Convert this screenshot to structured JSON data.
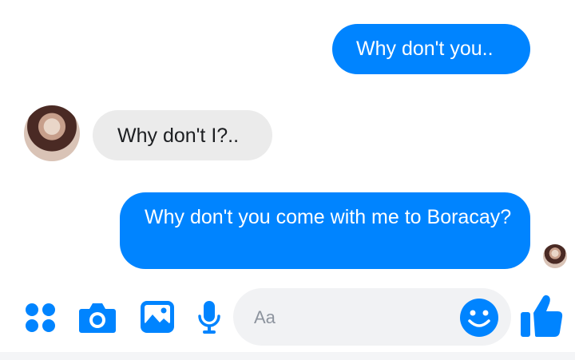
{
  "messages": [
    {
      "direction": "outgoing",
      "text": "Why don't you.."
    },
    {
      "direction": "incoming",
      "text": "Why don't I?.."
    },
    {
      "direction": "outgoing",
      "text": "Why don't you come with me to Boracay?"
    }
  ],
  "composer": {
    "placeholder": "Aa"
  },
  "toolbar": {
    "icons": [
      "more-apps-icon",
      "camera-icon",
      "gallery-icon",
      "microphone-icon",
      "emoji-icon",
      "thumbs-up-icon"
    ]
  },
  "colors": {
    "accent": "#0084ff",
    "incoming_bubble": "#ebebeb",
    "composer_bg": "#f1f2f4"
  }
}
